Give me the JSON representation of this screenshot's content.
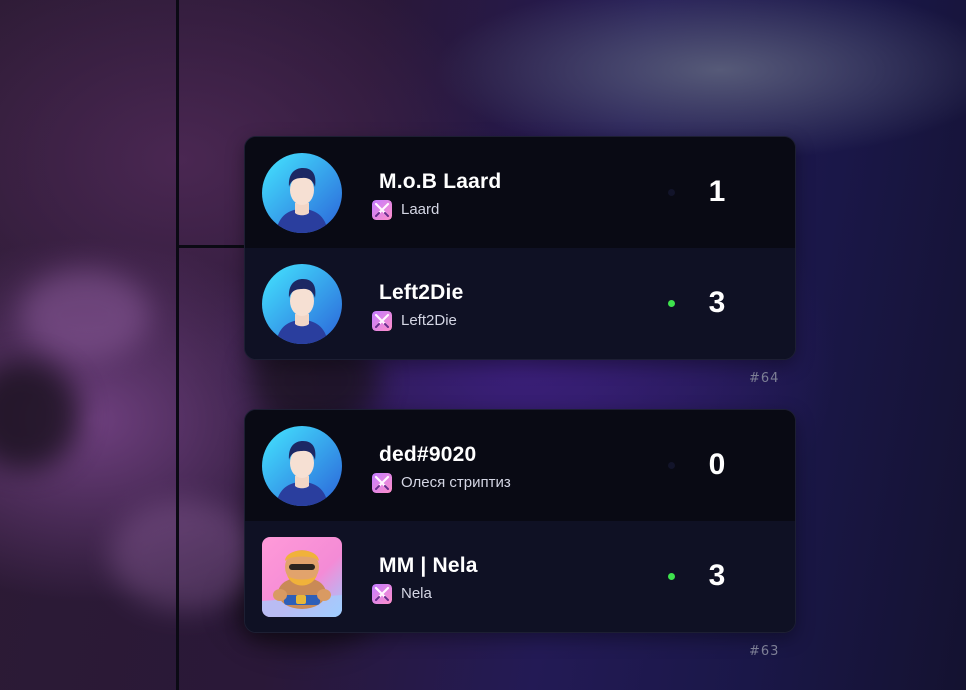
{
  "matches": [
    {
      "id_label": "#64",
      "teams": [
        {
          "name": "M.o.B Laard",
          "subtitle": "Laard",
          "score": "1",
          "online": false,
          "avatar_icon": "default-user-avatar-icon"
        },
        {
          "name": "Left2Die",
          "subtitle": "Left2Die",
          "score": "3",
          "online": true,
          "avatar_icon": "default-user-avatar-icon"
        }
      ]
    },
    {
      "id_label": "#63",
      "teams": [
        {
          "name": "ded#9020",
          "subtitle": "Олеся стриптиз",
          "score": "0",
          "online": false,
          "avatar_icon": "default-user-avatar-icon"
        },
        {
          "name": "MM | Nela",
          "subtitle": "Nela",
          "score": "3",
          "online": true,
          "avatar_icon": "barbarian-avatar-icon"
        }
      ]
    }
  ],
  "colors": {
    "online_dot": "#3ee24d",
    "card_top_row": "#090a14",
    "card_bottom_row": "#0f1124",
    "avatar_gradient_start": "#3fe0ff",
    "avatar_gradient_end": "#2c6fe0",
    "game_icon_gradient": [
      "#c77dff",
      "#ff89c8"
    ]
  }
}
